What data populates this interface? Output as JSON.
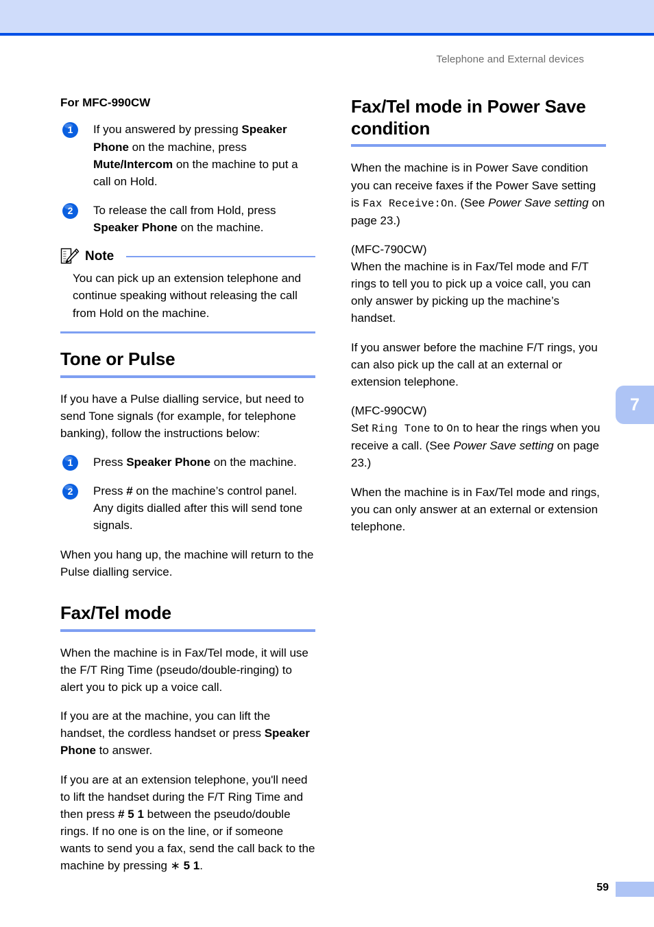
{
  "header": {
    "running_title": "Telephone and External devices"
  },
  "chapter_tab": {
    "number": "7"
  },
  "footer": {
    "page_number": "59"
  },
  "left_column": {
    "sub_heading": "For MFC-990CW",
    "steps_hold": [
      {
        "number": "1",
        "parts": [
          {
            "text": "If you answered by pressing ",
            "style": "normal"
          },
          {
            "text": "Speaker Phone",
            "style": "bold"
          },
          {
            "text": " on the machine, press ",
            "style": "normal"
          },
          {
            "text": "Mute/Intercom",
            "style": "bold"
          },
          {
            "text": " on the machine to put a call on Hold.",
            "style": "normal"
          }
        ]
      },
      {
        "number": "2",
        "parts": [
          {
            "text": "To release the call from Hold, press ",
            "style": "normal"
          },
          {
            "text": "Speaker Phone",
            "style": "bold"
          },
          {
            "text": " on the machine.",
            "style": "normal"
          }
        ]
      }
    ],
    "note": {
      "title": "Note",
      "body": "You can pick up an extension telephone and continue speaking without releasing the call from Hold on the machine."
    },
    "tone_or_pulse": {
      "heading": "Tone or Pulse",
      "intro": "If you have a Pulse dialling service, but need to send Tone signals (for example, for telephone banking), follow the instructions below:",
      "steps": [
        {
          "number": "1",
          "parts": [
            {
              "text": "Press ",
              "style": "normal"
            },
            {
              "text": "Speaker Phone",
              "style": "bold"
            },
            {
              "text": " on the machine.",
              "style": "normal"
            }
          ]
        },
        {
          "number": "2",
          "parts": [
            {
              "text": "Press ",
              "style": "normal"
            },
            {
              "text": "#",
              "style": "bold"
            },
            {
              "text": " on the machine’s control panel. Any digits dialled after this will send tone signals.",
              "style": "normal"
            }
          ]
        }
      ],
      "outro": "When you hang up, the machine will return to the Pulse dialling service."
    },
    "fax_tel_mode": {
      "heading": "Fax/Tel mode",
      "para1": "When the machine is in Fax/Tel mode, it will use the F/T Ring Time (pseudo/double-ringing) to alert you to pick up a voice call.",
      "para2_parts": [
        {
          "text": "If you are at the machine, you can lift the handset, the cordless handset or press ",
          "style": "normal"
        },
        {
          "text": "Speaker Phone",
          "style": "bold"
        },
        {
          "text": " to answer.",
          "style": "normal"
        }
      ],
      "para3_parts": [
        {
          "text": "If you are at an extension telephone, you'll need to lift the handset during the F/T Ring Time and then press ",
          "style": "normal"
        },
        {
          "text": "# 5 1",
          "style": "bold"
        },
        {
          "text": " between the pseudo/double rings. If no one is on the line, or if someone wants to send you a fax, send the call back to the machine by pressing ",
          "style": "normal"
        },
        {
          "text": "∗",
          "style": "normal"
        },
        {
          "text": " 5 1",
          "style": "bold"
        },
        {
          "text": ".",
          "style": "normal"
        }
      ]
    }
  },
  "right_column": {
    "power_save": {
      "heading": "Fax/Tel mode in Power Save condition",
      "para1_parts": [
        {
          "text": "When the machine is in Power Save condition you can receive faxes if the Power Save setting is ",
          "style": "normal"
        },
        {
          "text": "Fax Receive:On",
          "style": "mono"
        },
        {
          "text": ". (See ",
          "style": "normal"
        },
        {
          "text": "Power Save setting",
          "style": "italic"
        },
        {
          "text": " on page 23.)",
          "style": "normal"
        }
      ],
      "para2_label": "(MFC-790CW)",
      "para2": "When the machine is in Fax/Tel mode and F/T rings to tell you to pick up a voice call, you can only answer by picking up the machine’s handset.",
      "para3": "If you answer before the machine F/T rings, you can also pick up the call at an external or extension telephone.",
      "para4_label": "(MFC-990CW)",
      "para4_parts": [
        {
          "text": "Set ",
          "style": "normal"
        },
        {
          "text": "Ring Tone",
          "style": "mono"
        },
        {
          "text": " to ",
          "style": "normal"
        },
        {
          "text": "On",
          "style": "mono"
        },
        {
          "text": " to hear the rings when you receive a call. (See ",
          "style": "normal"
        },
        {
          "text": "Power Save setting",
          "style": "italic"
        },
        {
          "text": " on page 23.)",
          "style": "normal"
        }
      ],
      "para5": "When the machine is in Fax/Tel mode and rings, you can only answer at an external or extension telephone."
    }
  },
  "colors": {
    "band_light_blue": "#cfdcfa",
    "band_rule_blue": "#0050e6",
    "heading_rule_blue": "#7e9ff2",
    "step_badge_blue": "#0a5fe0",
    "tab_blue": "#aec4f5",
    "header_text_gray": "#6d6d6d"
  }
}
